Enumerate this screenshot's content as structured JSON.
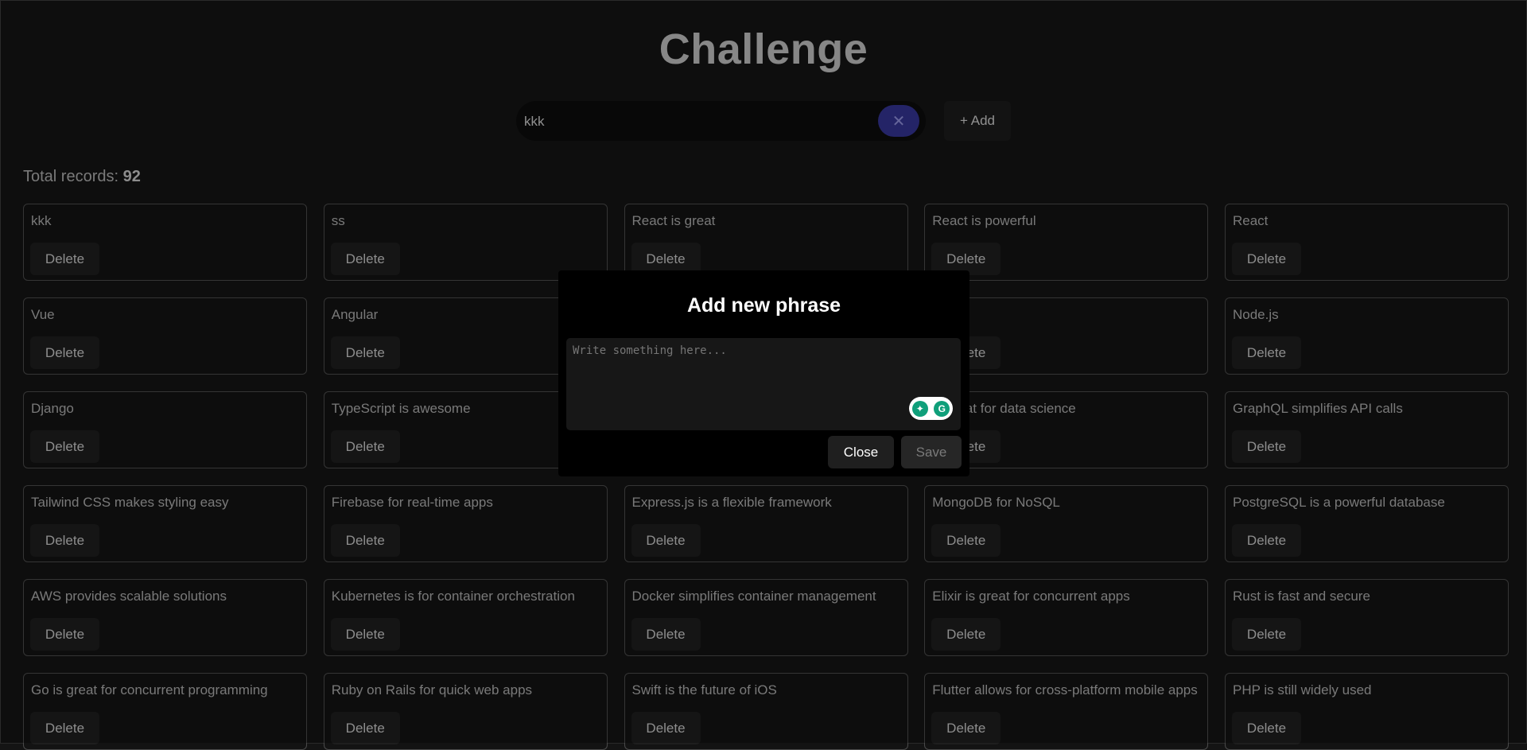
{
  "header": {
    "title": "Challenge"
  },
  "search": {
    "value": "kkk",
    "clear_label": "✕"
  },
  "toolbar": {
    "add_label": "+ Add"
  },
  "summary": {
    "label": "Total records:",
    "count": "92"
  },
  "card_delete_label": "Delete",
  "cards": [
    "kkk",
    "ss",
    "React is great",
    "React is powerful",
    "React",
    "Vue",
    "Angular",
    "",
    "",
    "Node.js",
    "Django",
    "TypeScript is awesome",
    "",
    "is great for data science",
    "GraphQL simplifies API calls",
    "Tailwind CSS makes styling easy",
    "Firebase for real-time apps",
    "Express.js is a flexible framework",
    "MongoDB for NoSQL",
    "PostgreSQL is a powerful database",
    "AWS provides scalable solutions",
    "Kubernetes is for container orchestration",
    "Docker simplifies container management",
    "Elixir is great for concurrent apps",
    "Rust is fast and secure",
    "Go is great for concurrent programming",
    "Ruby on Rails for quick web apps",
    "Swift is the future of iOS",
    "Flutter allows for cross-platform mobile apps",
    "PHP is still widely used"
  ],
  "modal": {
    "title": "Add new phrase",
    "placeholder": "Write something here...",
    "close_label": "Close",
    "save_label": "Save"
  },
  "colors": {
    "accent": "#33338f",
    "background": "#141414",
    "modal_bg": "#000000"
  }
}
